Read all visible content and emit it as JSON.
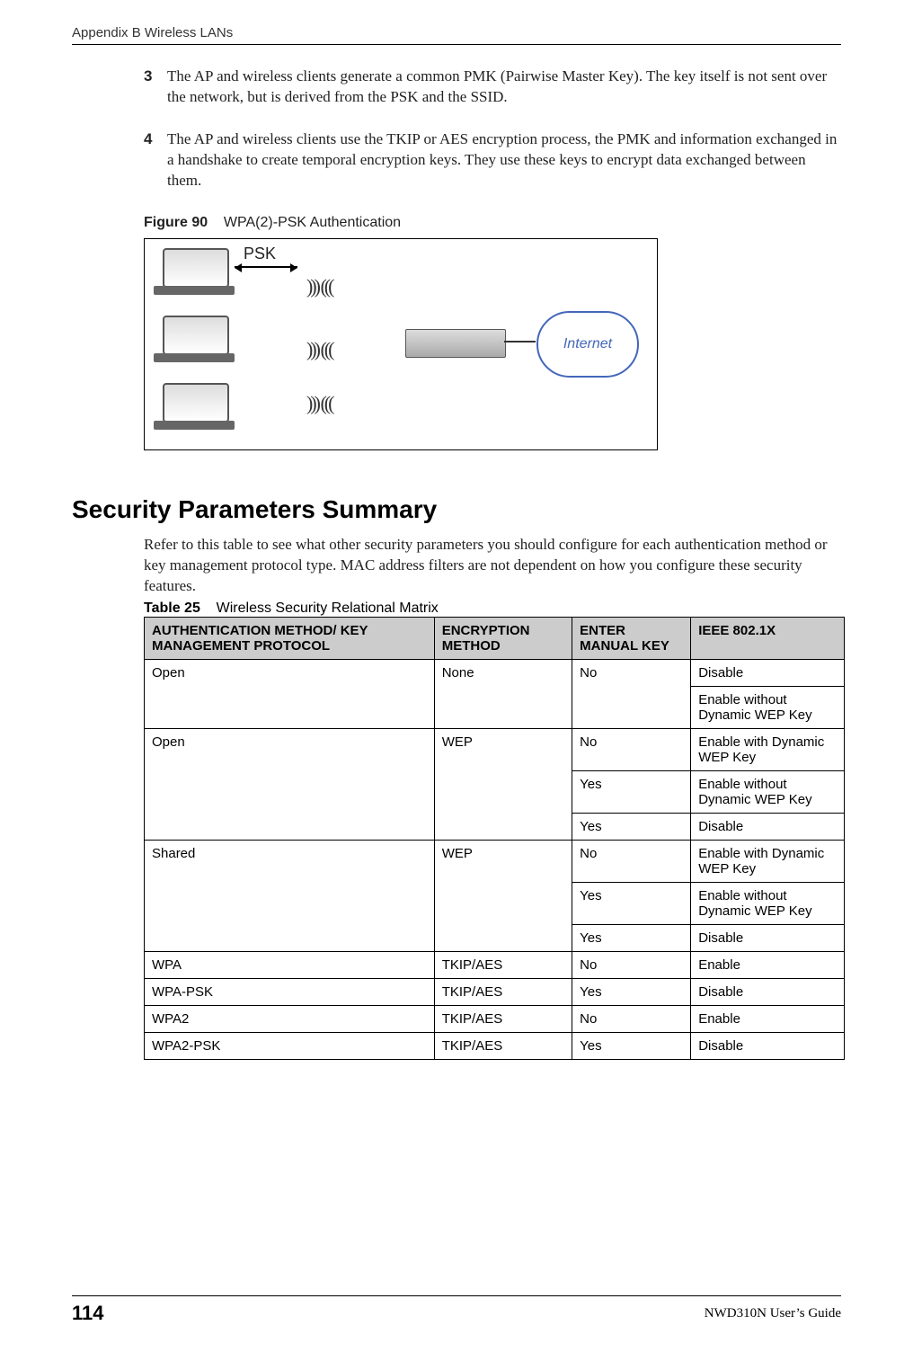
{
  "header": {
    "left": "Appendix B Wireless LANs",
    "right": ""
  },
  "list": {
    "item3_num": "3",
    "item3_text": "The AP and wireless clients generate a common PMK (Pairwise Master Key). The key itself is not sent over the network, but is derived from the PSK and the SSID.",
    "item4_num": "4",
    "item4_text": "The AP and wireless clients use the TKIP or AES encryption process, the PMK and information exchanged in a handshake to create temporal encryption keys. They use these keys to encrypt data exchanged between them."
  },
  "figure": {
    "label": "Figure 90",
    "caption": "WPA(2)-PSK Authentication",
    "psk_label": "PSK",
    "cloud_label": "Internet"
  },
  "section": {
    "heading": "Security Parameters Summary",
    "text": "Refer to this table to see what other security parameters you should configure for each authentication method or key management protocol type. MAC address filters are not dependent on how you configure these security features."
  },
  "table": {
    "label": "Table 25",
    "caption": "Wireless Security Relational Matrix",
    "headers": {
      "h1": "AUTHENTICATION METHOD/ KEY MANAGEMENT PROTOCOL",
      "h2": "ENCRYPTION METHOD",
      "h3": "ENTER MANUAL KEY",
      "h4": "IEEE 802.1X"
    },
    "rows": {
      "r1": {
        "auth": "Open",
        "enc": "None",
        "key": "No",
        "ieee": "Disable"
      },
      "r2": {
        "ieee": "Enable without Dynamic WEP Key"
      },
      "r3": {
        "auth": "Open",
        "enc": "WEP",
        "key": "No",
        "ieee": "Enable with Dynamic WEP Key"
      },
      "r4": {
        "key": "Yes",
        "ieee": "Enable without Dynamic WEP Key"
      },
      "r5": {
        "key": "Yes",
        "ieee": "Disable"
      },
      "r6": {
        "auth": "Shared",
        "enc": "WEP",
        "key": "No",
        "ieee": "Enable with Dynamic WEP Key"
      },
      "r7": {
        "key": "Yes",
        "ieee": "Enable without Dynamic WEP Key"
      },
      "r8": {
        "key": "Yes",
        "ieee": "Disable"
      },
      "r9": {
        "auth": "WPA",
        "enc": "TKIP/AES",
        "key": "No",
        "ieee": "Enable"
      },
      "r10": {
        "auth": "WPA-PSK",
        "enc": "TKIP/AES",
        "key": "Yes",
        "ieee": "Disable"
      },
      "r11": {
        "auth": "WPA2",
        "enc": "TKIP/AES",
        "key": "No",
        "ieee": "Enable"
      },
      "r12": {
        "auth": "WPA2-PSK",
        "enc": "TKIP/AES",
        "key": "Yes",
        "ieee": "Disable"
      }
    }
  },
  "footer": {
    "page": "114",
    "guide": "NWD310N User’s Guide"
  }
}
